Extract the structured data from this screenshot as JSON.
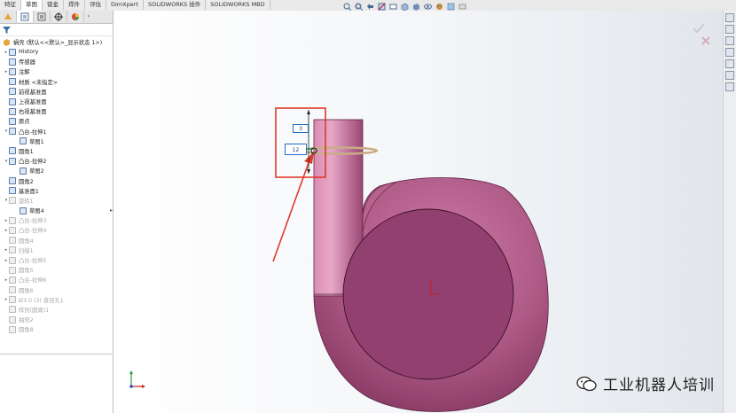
{
  "command_tabs": [
    "特征",
    "草图",
    "钣金",
    "焊件",
    "评估",
    "DimXpert",
    "SOLIDWORKS 插件",
    "SOLIDWORKS MBD"
  ],
  "active_tab": "草图",
  "tree": {
    "root_label": "蜗壳 (默认<<默认>_显示状态 1>)",
    "items": [
      {
        "label": "History",
        "indent": 1,
        "expand": "▸",
        "suppressed": false
      },
      {
        "label": "传感器",
        "indent": 1,
        "expand": "",
        "suppressed": false
      },
      {
        "label": "注解",
        "indent": 1,
        "expand": "▸",
        "suppressed": false
      },
      {
        "label": "材质 <未指定>",
        "indent": 1,
        "expand": "",
        "suppressed": false
      },
      {
        "label": "前视基准面",
        "indent": 1,
        "expand": "",
        "suppressed": false
      },
      {
        "label": "上视基准面",
        "indent": 1,
        "expand": "",
        "suppressed": false
      },
      {
        "label": "右视基准面",
        "indent": 1,
        "expand": "",
        "suppressed": false
      },
      {
        "label": "原点",
        "indent": 1,
        "expand": "",
        "suppressed": false
      },
      {
        "label": "凸台-拉伸1",
        "indent": 1,
        "expand": "▾",
        "suppressed": false
      },
      {
        "label": "草图1",
        "indent": 2,
        "expand": "",
        "suppressed": false
      },
      {
        "label": "圆角1",
        "indent": 1,
        "expand": "",
        "suppressed": false
      },
      {
        "label": "凸台-拉伸2",
        "indent": 1,
        "expand": "▾",
        "suppressed": false
      },
      {
        "label": "草图2",
        "indent": 2,
        "expand": "",
        "suppressed": false
      },
      {
        "label": "圆角2",
        "indent": 1,
        "expand": "",
        "suppressed": false
      },
      {
        "label": "基准面1",
        "indent": 1,
        "expand": "",
        "suppressed": false
      },
      {
        "label": "旋转1",
        "indent": 1,
        "expand": "▾",
        "suppressed": true
      },
      {
        "label": "草图4",
        "indent": 2,
        "expand": "",
        "suppressed": false
      },
      {
        "label": "凸台-拉伸3",
        "indent": 1,
        "expand": "▸",
        "suppressed": true
      },
      {
        "label": "凸台-拉伸4",
        "indent": 1,
        "expand": "▸",
        "suppressed": true
      },
      {
        "label": "圆角4",
        "indent": 1,
        "expand": "",
        "suppressed": true
      },
      {
        "label": "扫描1",
        "indent": 1,
        "expand": "▸",
        "suppressed": true
      },
      {
        "label": "凸台-拉伸5",
        "indent": 1,
        "expand": "▸",
        "suppressed": true
      },
      {
        "label": "圆角5",
        "indent": 1,
        "expand": "",
        "suppressed": true
      },
      {
        "label": "凸台-拉伸6",
        "indent": 1,
        "expand": "▸",
        "suppressed": true
      },
      {
        "label": "圆角6",
        "indent": 1,
        "expand": "",
        "suppressed": true
      },
      {
        "label": "Ø3.0 (3) 直径孔1",
        "indent": 1,
        "expand": "▸",
        "suppressed": true
      },
      {
        "label": "阵列(圆周)1",
        "indent": 1,
        "expand": "",
        "suppressed": true
      },
      {
        "label": "抽壳2",
        "indent": 1,
        "expand": "",
        "suppressed": true
      },
      {
        "label": "圆角8",
        "indent": 1,
        "expand": "",
        "suppressed": true
      }
    ]
  },
  "dimensions": {
    "upper": "3",
    "lower": "12"
  },
  "watermark": "工业机器人培训",
  "colors": {
    "part": "#a0507a",
    "part_dark": "#6e2a50",
    "callout": "#e03a2a",
    "dimension": "#1f6fc8"
  }
}
